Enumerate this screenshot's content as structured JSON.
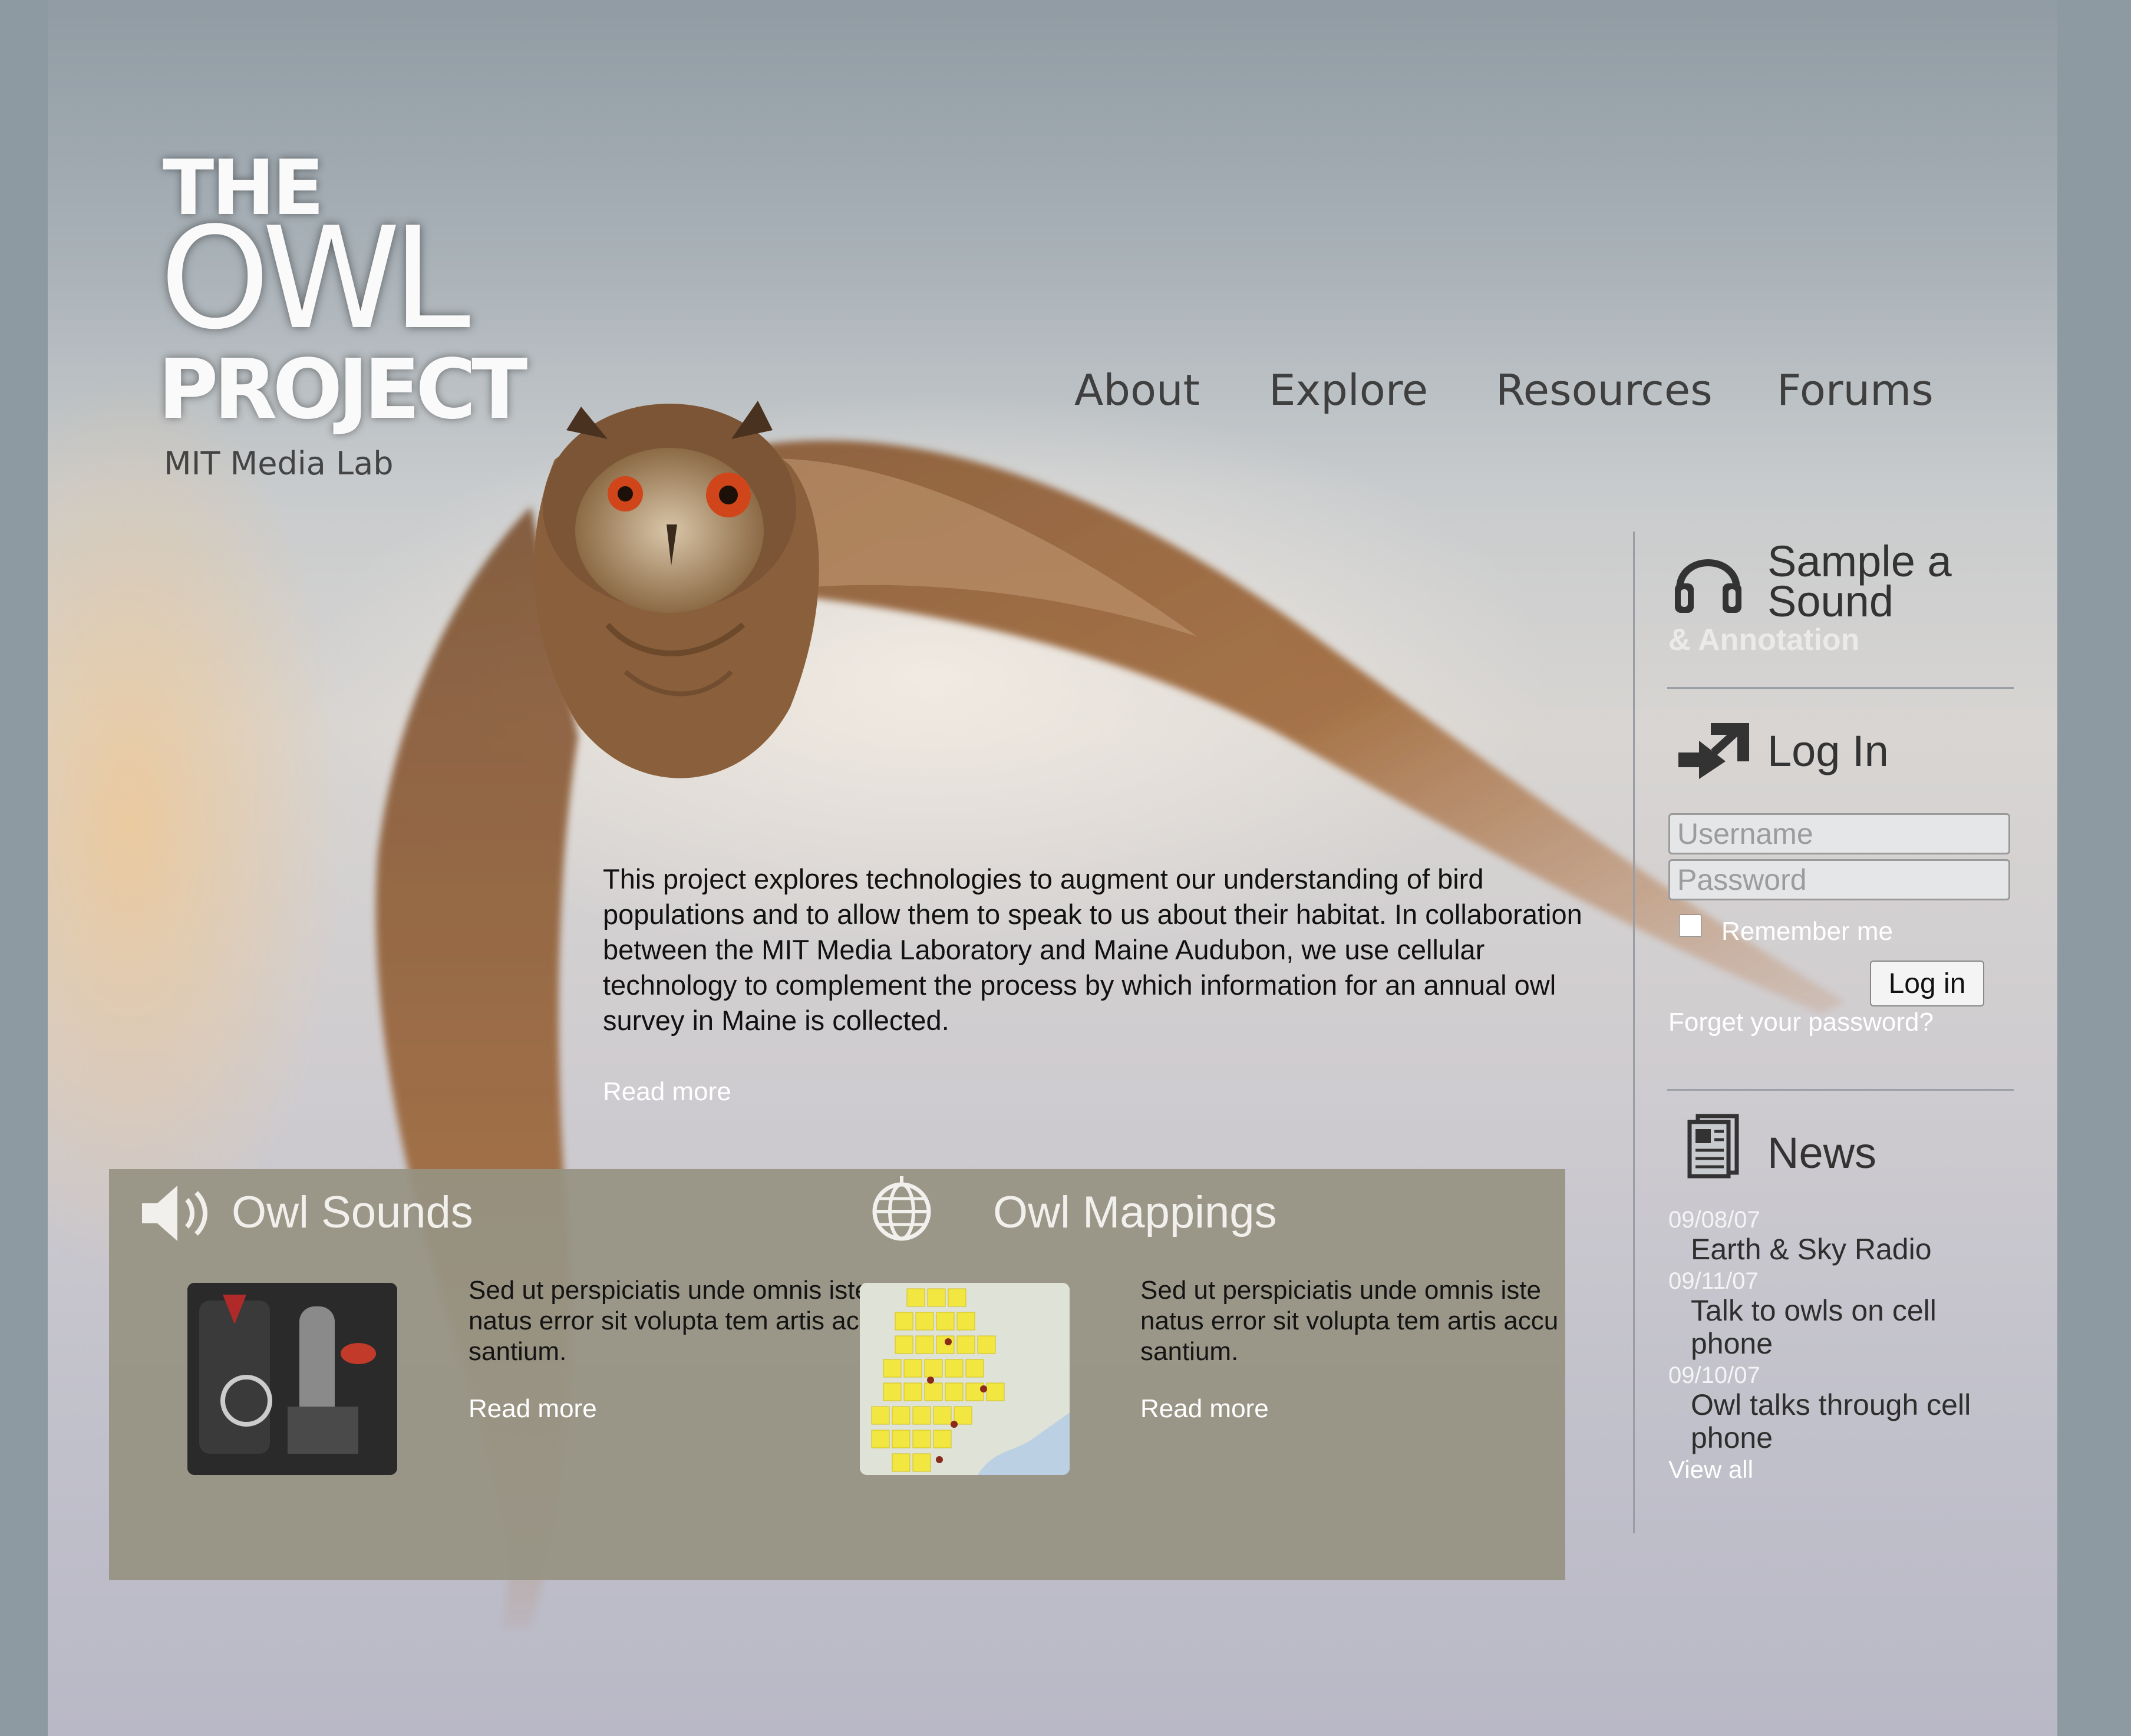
{
  "brand": {
    "logo_line1": "THE",
    "logo_line2": "OWL",
    "logo_line3": "PROJECT",
    "logo_sub": "MIT Media Lab"
  },
  "nav": {
    "items": [
      {
        "label": "About"
      },
      {
        "label": "Explore"
      },
      {
        "label": "Resources"
      },
      {
        "label": "Forums"
      }
    ]
  },
  "intro": {
    "text": "This project explores technologies to augment our understanding of bird populations and to allow them to speak to us about their habitat. In collaboration between the MIT Media Laboratory and Maine Audubon, we use cellular technology to complement the process by which information for an annual owl survey in Maine is collected.",
    "read_more": "Read more"
  },
  "features": {
    "sounds": {
      "title": "Owl Sounds",
      "icon": "speaker-icon",
      "text": "Sed ut perspiciatis unde omnis iste natus error sit volupta tem artis accu santium.",
      "read_more": "Read more"
    },
    "mappings": {
      "title": "Owl Mappings",
      "icon": "globe-icon",
      "text": "Sed ut perspiciatis unde omnis iste natus error sit volupta tem artis accu santium.",
      "read_more": "Read more"
    }
  },
  "sidebar": {
    "sample": {
      "icon": "headphones-icon",
      "title_line1": "Sample a",
      "title_line2": "Sound",
      "subtitle": "& Annotation"
    },
    "login": {
      "icon": "login-arrow-icon",
      "title": "Log In",
      "username_placeholder": "Username",
      "password_placeholder": "Password",
      "remember_label": "Remember me",
      "button_label": "Log in",
      "forgot_label": "Forget your password?"
    },
    "news": {
      "icon": "newspaper-icon",
      "title": "News",
      "items": [
        {
          "date": "09/08/07",
          "title": "Earth & Sky Radio"
        },
        {
          "date": "09/11/07",
          "title": "Talk to owls on cell phone"
        },
        {
          "date": "09/10/07",
          "title": "Owl talks through cell phone"
        }
      ],
      "view_all": "View all"
    }
  },
  "colors": {
    "panel_bg": "#969282",
    "nav_text": "#3f3f3f",
    "link_text": "#ffffff"
  }
}
